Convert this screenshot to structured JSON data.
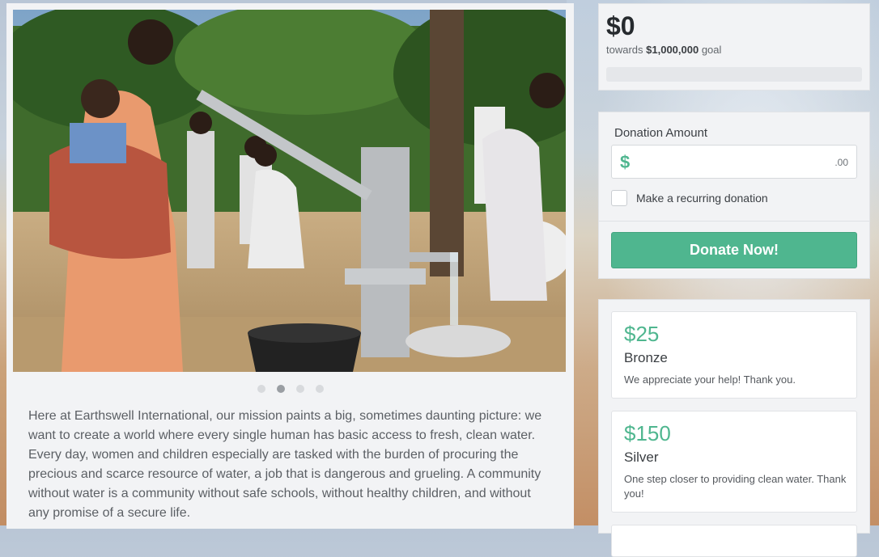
{
  "campaign": {
    "raised": "$0",
    "goal_prefix": "towards ",
    "goal_amount": "$1,000,000",
    "goal_suffix": " goal",
    "progress_fraction": 0.0
  },
  "donation": {
    "amount_label": "Donation Amount",
    "currency_symbol": "$",
    "cents_suffix": ".00",
    "amount_value": "",
    "recurring_label": "Make a recurring donation",
    "recurring_checked": false,
    "donate_button": "Donate Now!"
  },
  "tiers": [
    {
      "amount": "$25",
      "name": "Bronze",
      "description": "We appreciate your help! Thank you."
    },
    {
      "amount": "$150",
      "name": "Silver",
      "description": "One step closer to providing clean water. Thank you!"
    }
  ],
  "carousel": {
    "slide_count": 4,
    "active_index": 1
  },
  "mission_text": "Here at Earthswell International, our mission paints a big, sometimes daunting picture: we want to create a world where every single human has basic access to fresh, clean water. Every day, women and children especially are tasked with the burden of procuring the precious and scarce resource of water, a job that is dangerous and grueling. A community without water is a community without safe schools, without healthy children, and without any promise of a secure life.",
  "colors": {
    "accent": "#4fb68f",
    "panel": "#f2f3f5",
    "text": "#5b5f64"
  }
}
